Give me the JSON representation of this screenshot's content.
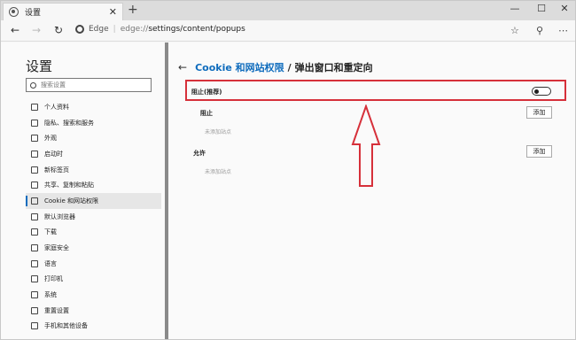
{
  "tab": {
    "title": "设置",
    "close": "✕",
    "new": "+"
  },
  "window": {
    "minimize": "—",
    "maximize": "☐",
    "close": "✕"
  },
  "address": {
    "brand": "Edge",
    "separator": "|",
    "host": "edge://",
    "path": "settings/content/popups"
  },
  "sidebar": {
    "title": "设置",
    "search_placeholder": "搜索设置",
    "items": [
      {
        "label": "个人资料"
      },
      {
        "label": "隐私、搜索和服务"
      },
      {
        "label": "外观"
      },
      {
        "label": "启动时"
      },
      {
        "label": "新标签页"
      },
      {
        "label": "共享、复制和粘贴"
      },
      {
        "label": "Cookie 和网站权限"
      },
      {
        "label": "默认浏览器"
      },
      {
        "label": "下载"
      },
      {
        "label": "家庭安全"
      },
      {
        "label": "语言"
      },
      {
        "label": "打印机"
      },
      {
        "label": "系统"
      },
      {
        "label": "重置设置"
      },
      {
        "label": "手机和其他设备"
      }
    ]
  },
  "main": {
    "breadcrumb": "Cookie 和网站权限",
    "slash": "/",
    "title": "弹出窗口和重定向",
    "block_recommended": "阻止(推荐)",
    "toggle_on": false,
    "block_section": "阻止",
    "block_empty": "未添加站点",
    "allow_section": "允许",
    "allow_empty": "未添加站点",
    "add_label": "添加"
  },
  "colors": {
    "accent": "#0f6cbd",
    "highlight": "#d6303a"
  }
}
